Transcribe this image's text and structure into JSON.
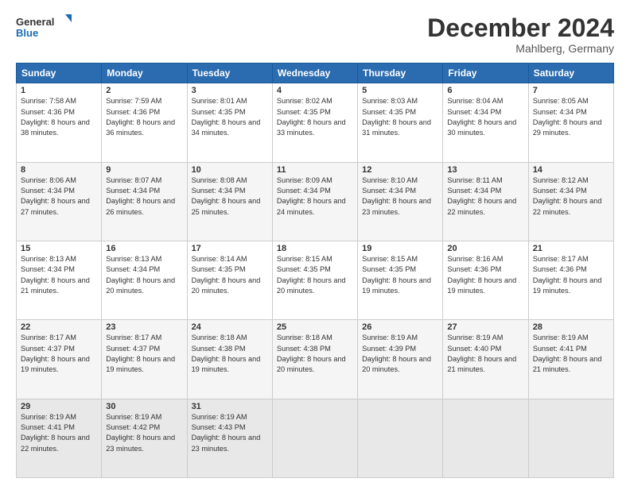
{
  "logo": {
    "line1": "General",
    "line2": "Blue"
  },
  "title": "December 2024",
  "subtitle": "Mahlberg, Germany",
  "headers": [
    "Sunday",
    "Monday",
    "Tuesday",
    "Wednesday",
    "Thursday",
    "Friday",
    "Saturday"
  ],
  "weeks": [
    [
      {
        "day": "1",
        "sunrise": "7:58 AM",
        "sunset": "4:36 PM",
        "daylight": "8 hours and 38 minutes."
      },
      {
        "day": "2",
        "sunrise": "7:59 AM",
        "sunset": "4:36 PM",
        "daylight": "8 hours and 36 minutes."
      },
      {
        "day": "3",
        "sunrise": "8:01 AM",
        "sunset": "4:35 PM",
        "daylight": "8 hours and 34 minutes."
      },
      {
        "day": "4",
        "sunrise": "8:02 AM",
        "sunset": "4:35 PM",
        "daylight": "8 hours and 33 minutes."
      },
      {
        "day": "5",
        "sunrise": "8:03 AM",
        "sunset": "4:35 PM",
        "daylight": "8 hours and 31 minutes."
      },
      {
        "day": "6",
        "sunrise": "8:04 AM",
        "sunset": "4:34 PM",
        "daylight": "8 hours and 30 minutes."
      },
      {
        "day": "7",
        "sunrise": "8:05 AM",
        "sunset": "4:34 PM",
        "daylight": "8 hours and 29 minutes."
      }
    ],
    [
      {
        "day": "8",
        "sunrise": "8:06 AM",
        "sunset": "4:34 PM",
        "daylight": "8 hours and 27 minutes."
      },
      {
        "day": "9",
        "sunrise": "8:07 AM",
        "sunset": "4:34 PM",
        "daylight": "8 hours and 26 minutes."
      },
      {
        "day": "10",
        "sunrise": "8:08 AM",
        "sunset": "4:34 PM",
        "daylight": "8 hours and 25 minutes."
      },
      {
        "day": "11",
        "sunrise": "8:09 AM",
        "sunset": "4:34 PM",
        "daylight": "8 hours and 24 minutes."
      },
      {
        "day": "12",
        "sunrise": "8:10 AM",
        "sunset": "4:34 PM",
        "daylight": "8 hours and 23 minutes."
      },
      {
        "day": "13",
        "sunrise": "8:11 AM",
        "sunset": "4:34 PM",
        "daylight": "8 hours and 22 minutes."
      },
      {
        "day": "14",
        "sunrise": "8:12 AM",
        "sunset": "4:34 PM",
        "daylight": "8 hours and 22 minutes."
      }
    ],
    [
      {
        "day": "15",
        "sunrise": "8:13 AM",
        "sunset": "4:34 PM",
        "daylight": "8 hours and 21 minutes."
      },
      {
        "day": "16",
        "sunrise": "8:13 AM",
        "sunset": "4:34 PM",
        "daylight": "8 hours and 20 minutes."
      },
      {
        "day": "17",
        "sunrise": "8:14 AM",
        "sunset": "4:35 PM",
        "daylight": "8 hours and 20 minutes."
      },
      {
        "day": "18",
        "sunrise": "8:15 AM",
        "sunset": "4:35 PM",
        "daylight": "8 hours and 20 minutes."
      },
      {
        "day": "19",
        "sunrise": "8:15 AM",
        "sunset": "4:35 PM",
        "daylight": "8 hours and 19 minutes."
      },
      {
        "day": "20",
        "sunrise": "8:16 AM",
        "sunset": "4:36 PM",
        "daylight": "8 hours and 19 minutes."
      },
      {
        "day": "21",
        "sunrise": "8:17 AM",
        "sunset": "4:36 PM",
        "daylight": "8 hours and 19 minutes."
      }
    ],
    [
      {
        "day": "22",
        "sunrise": "8:17 AM",
        "sunset": "4:37 PM",
        "daylight": "8 hours and 19 minutes."
      },
      {
        "day": "23",
        "sunrise": "8:17 AM",
        "sunset": "4:37 PM",
        "daylight": "8 hours and 19 minutes."
      },
      {
        "day": "24",
        "sunrise": "8:18 AM",
        "sunset": "4:38 PM",
        "daylight": "8 hours and 19 minutes."
      },
      {
        "day": "25",
        "sunrise": "8:18 AM",
        "sunset": "4:38 PM",
        "daylight": "8 hours and 20 minutes."
      },
      {
        "day": "26",
        "sunrise": "8:19 AM",
        "sunset": "4:39 PM",
        "daylight": "8 hours and 20 minutes."
      },
      {
        "day": "27",
        "sunrise": "8:19 AM",
        "sunset": "4:40 PM",
        "daylight": "8 hours and 21 minutes."
      },
      {
        "day": "28",
        "sunrise": "8:19 AM",
        "sunset": "4:41 PM",
        "daylight": "8 hours and 21 minutes."
      }
    ],
    [
      {
        "day": "29",
        "sunrise": "8:19 AM",
        "sunset": "4:41 PM",
        "daylight": "8 hours and 22 minutes."
      },
      {
        "day": "30",
        "sunrise": "8:19 AM",
        "sunset": "4:42 PM",
        "daylight": "8 hours and 23 minutes."
      },
      {
        "day": "31",
        "sunrise": "8:19 AM",
        "sunset": "4:43 PM",
        "daylight": "8 hours and 23 minutes."
      },
      null,
      null,
      null,
      null
    ]
  ]
}
